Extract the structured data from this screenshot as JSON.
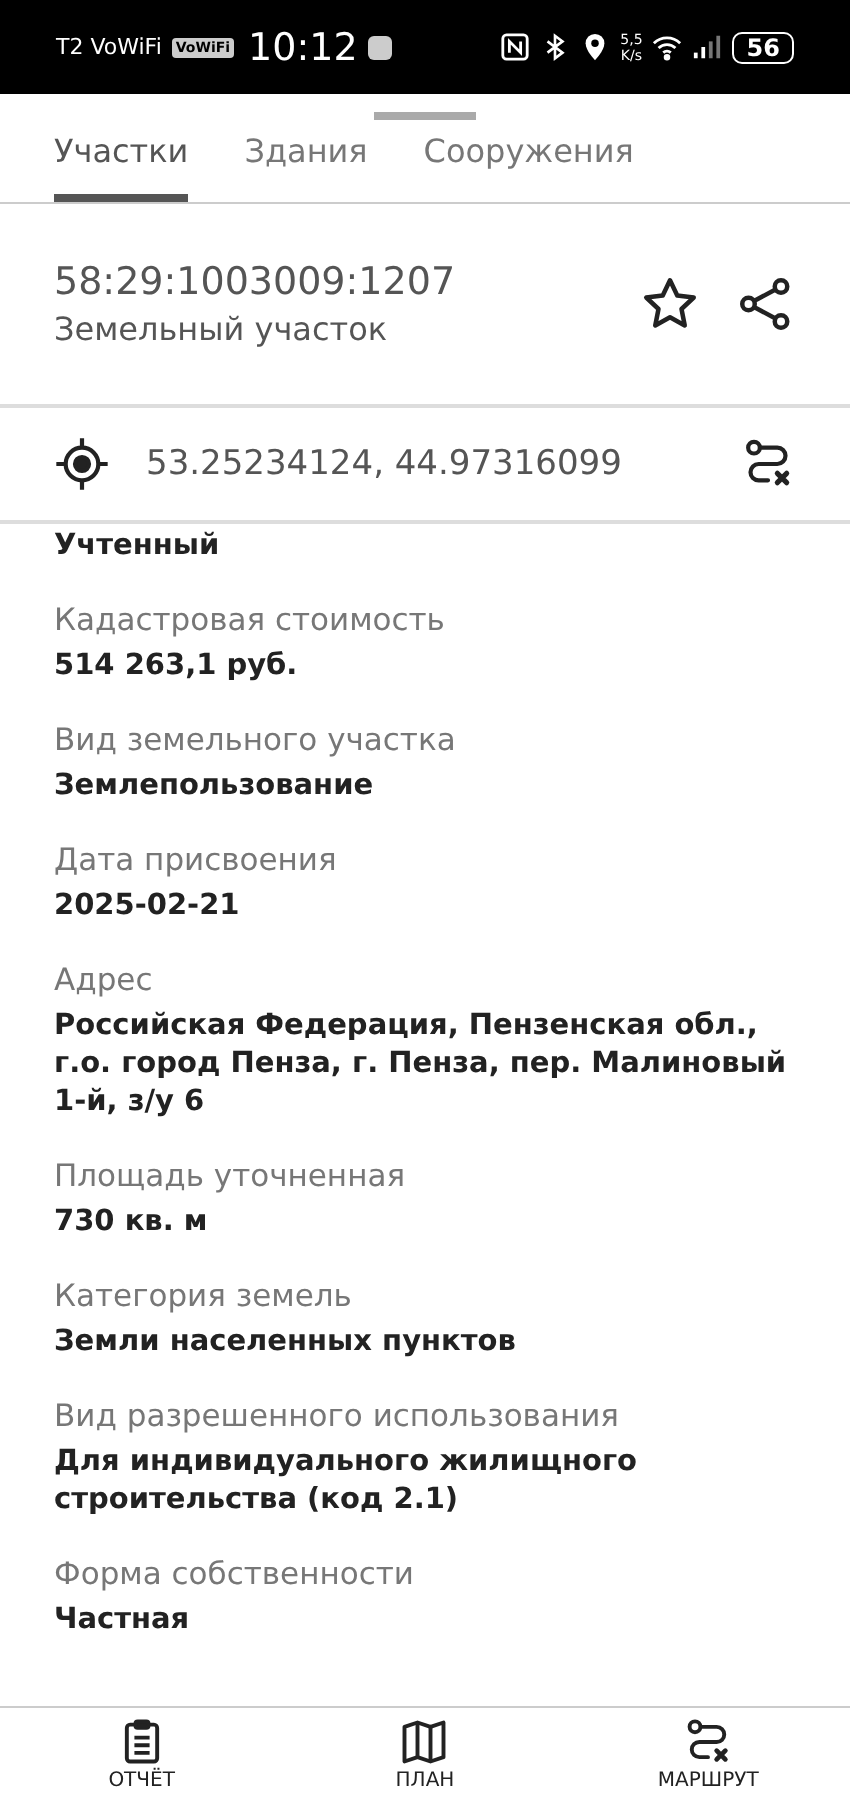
{
  "status_bar": {
    "carrier": "T2 VoWiFi",
    "vowifi_badge": "VoWiFi",
    "time": "10:12",
    "net_speed": "5,5",
    "net_unit": "K/s",
    "battery": "56"
  },
  "tabs": [
    {
      "label": "Участки",
      "selected": true
    },
    {
      "label": "Здания",
      "selected": false
    },
    {
      "label": "Сооружения",
      "selected": false
    }
  ],
  "object": {
    "number": "58:29:1003009:1207",
    "type": "Земельный участок"
  },
  "coordinates": "53.25234124, 44.97316099",
  "fields": [
    {
      "value": "Учтенный"
    },
    {
      "label": "Кадастровая стоимость",
      "value": "514 263,1 руб."
    },
    {
      "label": "Вид земельного участка",
      "value": "Землепользование"
    },
    {
      "label": "Дата присвоения",
      "value": "2025-02-21"
    },
    {
      "label": "Адрес",
      "value": "Российская Федерация, Пензенская обл., г.о. город Пенза, г. Пенза, пер. Малиновый 1-й, з/у 6"
    },
    {
      "label": "Площадь уточненная",
      "value": "730 кв. м"
    },
    {
      "label": "Категория земель",
      "value": "Земли населенных пунктов"
    },
    {
      "label": "Вид разрешенного использования",
      "value": "Для индивидуального жилищного строительства (код 2.1)"
    },
    {
      "label": "Форма собственности",
      "value": "Частная"
    }
  ],
  "bottom_nav": [
    {
      "kind": "report",
      "label": "ОТЧЁТ"
    },
    {
      "kind": "plan",
      "label": "ПЛАН"
    },
    {
      "kind": "route",
      "label": "МАРШРУТ"
    }
  ]
}
